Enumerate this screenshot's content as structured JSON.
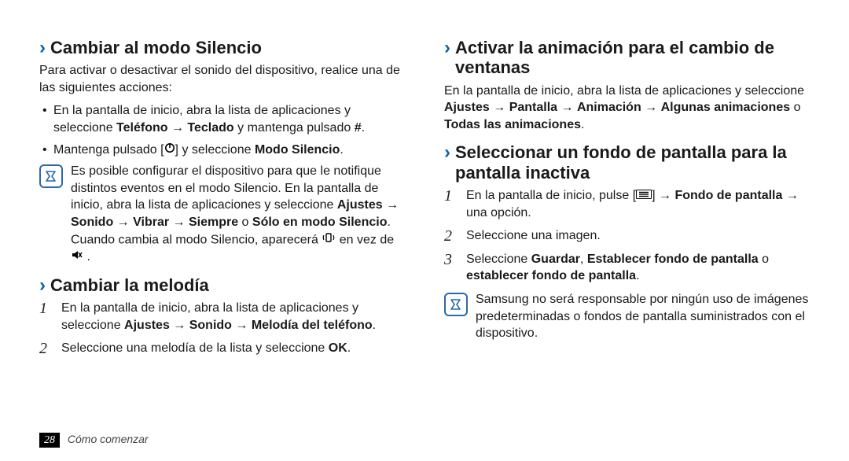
{
  "left": {
    "s1": {
      "title": "Cambiar al modo Silencio",
      "intro": "Para activar o desactivar el sonido del dispositivo, realice una de las siguientes acciones:",
      "b1a": "En la pantalla de inicio, abra la lista de aplicaciones y seleccione ",
      "b1b": "Teléfono",
      "b1c": " → ",
      "b1d": "Teclado",
      "b1e": " y mantenga pulsado ",
      "b1f": "#",
      "b1g": ".",
      "b2a": "Mantenga pulsado [",
      "b2b": "] y seleccione ",
      "b2c": "Modo Silencio",
      "b2d": ".",
      "note_a": "Es posible configurar el dispositivo para que le notifique distintos eventos en el modo Silencio. En la pantalla de inicio, abra la lista de aplicaciones y seleccione ",
      "note_b": "Ajustes",
      "note_c": " → ",
      "note_d": "Sonido",
      "note_e": " → ",
      "note_f": "Vibrar",
      "note_g": " → ",
      "note_h": "Siempre",
      "note_i": " o ",
      "note_j": "Sólo en modo Silencio",
      "note_k": ". Cuando cambia al modo Silencio, aparecerá ",
      "note_l": " en vez de ",
      "note_m": " ."
    },
    "s2": {
      "title": "Cambiar la melodía",
      "n1a": "En la pantalla de inicio, abra la lista de aplicaciones y seleccione ",
      "n1b": "Ajustes",
      "n1c": " → ",
      "n1d": "Sonido",
      "n1e": " → ",
      "n1f": "Melodía del teléfono",
      "n1g": ".",
      "n2a": "Seleccione una melodía de la lista y seleccione ",
      "n2b": "OK",
      "n2c": "."
    }
  },
  "right": {
    "s3": {
      "title": "Activar la animación para el cambio de ventanas",
      "p_a": "En la pantalla de inicio, abra la lista de aplicaciones y seleccione ",
      "p_b": "Ajustes",
      "p_c": " → ",
      "p_d": "Pantalla",
      "p_e": " → ",
      "p_f": "Animación",
      "p_g": " → ",
      "p_h": "Algunas animaciones",
      "p_i": " o ",
      "p_j": "Todas las animaciones",
      "p_k": "."
    },
    "s4": {
      "title": "Seleccionar un fondo de pantalla para la pantalla inactiva",
      "n1a": "En la pantalla de inicio, pulse [",
      "n1b": "] → ",
      "n1c": "Fondo de pantalla",
      "n1d": " → una opción.",
      "n2": "Seleccione una imagen.",
      "n3a": "Seleccione ",
      "n3b": "Guardar",
      "n3c": ", ",
      "n3d": "Establecer fondo de pantalla",
      "n3e": " o ",
      "n3f": "establecer fondo de pantalla",
      "n3g": ".",
      "note": "Samsung no será responsable por ningún uso de imágenes predeterminadas o fondos de pantalla suministrados con el dispositivo."
    }
  },
  "footer": {
    "page": "28",
    "section": "Cómo comenzar"
  }
}
